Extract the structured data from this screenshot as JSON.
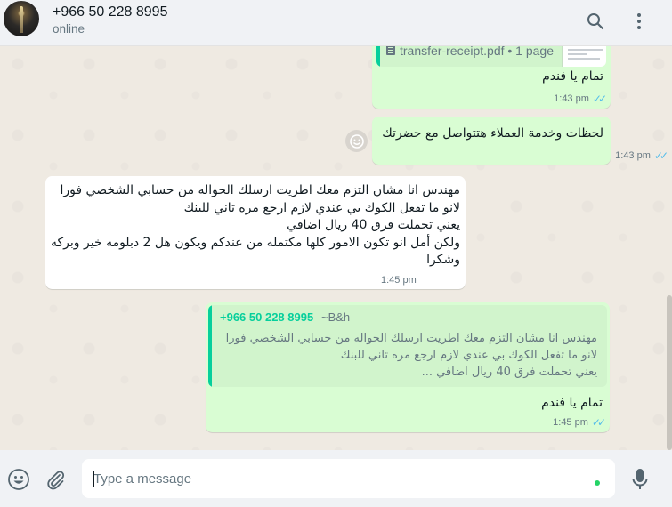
{
  "header": {
    "contact_name": "+966 50 228 8995",
    "status": "online",
    "icons": [
      "search-icon",
      "menu-icon"
    ]
  },
  "messages": [
    {
      "direction": "outgoing",
      "document": {
        "file_name": "transfer-receipt.pdf • 1 page"
      },
      "text": "تمام يا فندم",
      "time": "1:43 pm",
      "status": "read"
    },
    {
      "direction": "outgoing",
      "text": "لحظات وخدمة العملاء هتتواصل مع حضرتك",
      "time": "1:43 pm",
      "status": "read"
    },
    {
      "direction": "incoming",
      "lines": [
        "مهندس انا مشان التزم معك اطريت ارسلك الحواله من حسابي الشخصي فورا",
        "لانو ما تفعل الكوك بي عندي لازم ارجع مره تاني للبنك",
        "يعني تحملت فرق 40 ريال اضافي",
        "ولكن أمل انو تكون الامور كلها مكتمله من عندكم ويكون هل 2 دبلومه خير وبركه",
        "وشكرا"
      ],
      "time": "1:45 pm"
    },
    {
      "direction": "outgoing",
      "quote": {
        "number": "+966 50 228 8995",
        "sender": "~B&h",
        "lines": [
          "مهندس انا مشان التزم معك اطريت ارسلك الحواله من حسابي الشخصي فورا",
          "لانو ما تفعل الكوك بي عندي لازم ارجع مره تاني للبنك",
          "يعني تحملت فرق 40 ريال اضافي ..."
        ]
      },
      "text": "تمام يا فندم",
      "time": "1:45 pm",
      "status": "read"
    }
  ],
  "composer": {
    "placeholder": "Type a message",
    "icons": [
      "emoji-icon",
      "attach-icon",
      "microphone-icon"
    ]
  },
  "colors": {
    "outgoing_bubble": "#d9fdd3",
    "incoming_bubble": "#ffffff",
    "accent": "#06cf9c",
    "read_ticks": "#53bdeb",
    "chat_background": "#efeae2"
  }
}
